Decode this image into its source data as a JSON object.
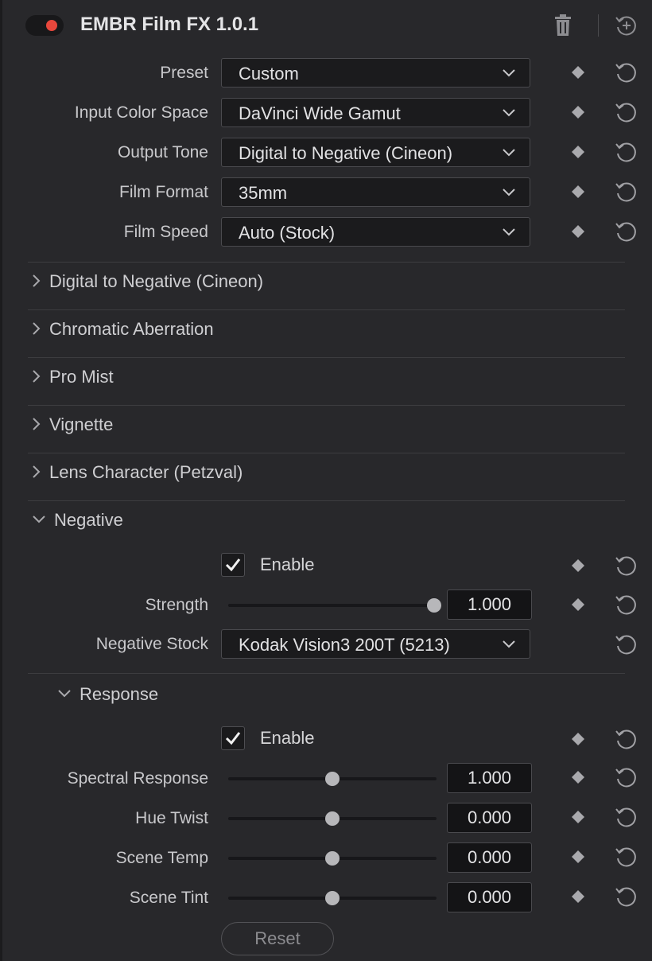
{
  "plugin": {
    "title": "EMBR Film FX 1.0.1",
    "enabled": true
  },
  "fields": [
    {
      "label": "Preset",
      "value": "Custom"
    },
    {
      "label": "Input Color Space",
      "value": "DaVinci Wide Gamut"
    },
    {
      "label": "Output Tone",
      "value": "Digital to Negative (Cineon)"
    },
    {
      "label": "Film Format",
      "value": "35mm"
    },
    {
      "label": "Film Speed",
      "value": "Auto (Stock)"
    }
  ],
  "sections": [
    {
      "label": "Digital to Negative (Cineon)",
      "expanded": false
    },
    {
      "label": "Chromatic Aberration",
      "expanded": false
    },
    {
      "label": "Pro Mist",
      "expanded": false
    },
    {
      "label": "Vignette",
      "expanded": false
    },
    {
      "label": "Lens Character (Petzval)",
      "expanded": false
    },
    {
      "label": "Negative",
      "expanded": true
    }
  ],
  "negative": {
    "enable_label": "Enable",
    "enabled": true,
    "strength": {
      "label": "Strength",
      "value": "1.000",
      "fraction": 1.0
    },
    "stock": {
      "label": "Negative Stock",
      "value": "Kodak Vision3 200T (5213)"
    }
  },
  "response": {
    "title": "Response",
    "expanded": true,
    "enable_label": "Enable",
    "enabled": true,
    "sliders": [
      {
        "label": "Spectral Response",
        "value": "1.000",
        "fraction": 0.5
      },
      {
        "label": "Hue Twist",
        "value": "0.000",
        "fraction": 0.5
      },
      {
        "label": "Scene Temp",
        "value": "0.000",
        "fraction": 0.5
      },
      {
        "label": "Scene Tint",
        "value": "0.000",
        "fraction": 0.5
      }
    ],
    "reset_label": "Reset"
  },
  "colors": {
    "background": "#28282b",
    "toggle_on": "#e8473c",
    "field_bg": "#1b1b1d"
  },
  "icons": [
    "trash-icon",
    "reset-all-icon",
    "chevron-down-icon",
    "chevron-right-icon",
    "keyframe-diamond-icon",
    "reset-icon",
    "checkmark-icon"
  ]
}
